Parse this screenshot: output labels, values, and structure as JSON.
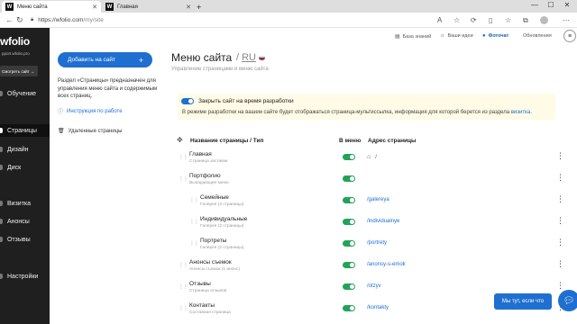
{
  "browser": {
    "tabs": [
      {
        "favicon": "W",
        "title": "Меню сайта",
        "active": true
      },
      {
        "favicon": "W",
        "title": "Главная",
        "active": false
      }
    ],
    "new_tab": "+",
    "url_host": "https://wfolio.com",
    "url_path": "/my/site"
  },
  "sidebar": {
    "logo": "wfolio",
    "site_sub": "pport.wfolio.pro",
    "view_site": "Смотреть сайт →",
    "items": [
      {
        "label": "Обучение",
        "active": false
      },
      {
        "label": "Страницы",
        "active": true
      },
      {
        "label": "Дизайн",
        "active": false
      },
      {
        "label": "Диск",
        "active": false
      },
      {
        "label": "Визитка",
        "active": false
      },
      {
        "label": "Анонсы",
        "active": false
      },
      {
        "label": "Отзывы",
        "active": false
      },
      {
        "label": "Настройки",
        "active": false
      }
    ]
  },
  "top_links": {
    "kb": "База знаний",
    "ideas": "Ваши идеи",
    "photo": "Фоточат",
    "updates": "Обновления"
  },
  "left": {
    "add_button": "Добавить на сайт",
    "description": "Раздел «Страницы» предназначен для управления меню сайта и содержимым всех страниц.",
    "instructions": "Инструкция по работе",
    "deleted": "Удаленные страницы"
  },
  "main": {
    "title": "Меню сайта",
    "lang_sep": "/",
    "lang": "RU",
    "subtitle": "Управление страницами и меню сайта",
    "dev_toggle_label": "Закрыть сайт на время разработки",
    "dev_text": "В режиме разработки на вашем сайте будет отображаться страница-мультиссылка, информация для которой берется из раздела",
    "dev_link": "визитка",
    "dev_period": "."
  },
  "table": {
    "col_name": "Название страницы / Тип",
    "col_menu": "В меню",
    "col_addr": "Адрес страницы",
    "rows": [
      {
        "name": "Главная",
        "type": "Страница заставки",
        "addr": "/",
        "home": true,
        "indent": 0,
        "in_menu": true
      },
      {
        "name": "Портфолио",
        "type": "Выпадающее меню",
        "addr": "",
        "home": false,
        "indent": 0,
        "in_menu": true
      },
      {
        "name": "Семейные",
        "type": "Галерея (3 страницы)",
        "addr": "/galereya",
        "home": false,
        "indent": 1,
        "in_menu": true
      },
      {
        "name": "Индивидуальные",
        "type": "Галерея (2 страницы)",
        "addr": "/individualnye",
        "home": false,
        "indent": 1,
        "in_menu": true
      },
      {
        "name": "Портреты",
        "type": "Галерея (2 страницы)",
        "addr": "/portrety",
        "home": false,
        "indent": 1,
        "in_menu": true
      },
      {
        "name": "Анонсы съемок",
        "type": "Анонсы съемок (1 анонс)",
        "addr": "/anonsy-s-emok",
        "home": false,
        "indent": 0,
        "in_menu": true
      },
      {
        "name": "Отзывы",
        "type": "Страница отзывов",
        "addr": "/otzyv",
        "home": false,
        "indent": 0,
        "in_menu": true
      },
      {
        "name": "Контакты",
        "type": "Составная страница",
        "addr": "/kontakty",
        "home": false,
        "indent": 0,
        "in_menu": true
      }
    ]
  },
  "help": "Мы тут, если что",
  "colors": {
    "accent": "#1f6fd1",
    "toggle_on": "#22a35a",
    "sidebar": "#1f1f1f",
    "notice": "#fffbe6"
  }
}
